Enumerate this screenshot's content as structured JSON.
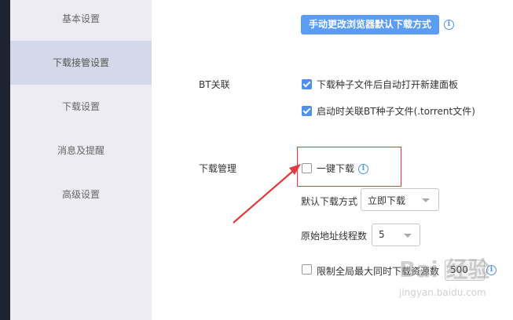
{
  "sidebar": {
    "items": [
      {
        "label": "基本设置"
      },
      {
        "label": "下载接管设置",
        "active": true
      },
      {
        "label": "下载设置"
      },
      {
        "label": "消息及提醒"
      },
      {
        "label": "高级设置"
      }
    ]
  },
  "main": {
    "top_button_label": "手动更改浏览器默认下载方式",
    "bt": {
      "section_label": "BT关联",
      "options": [
        {
          "label": "下载种子文件后自动打开新建面板",
          "checked": true
        },
        {
          "label": "启动时关联BT种子文件(.torrent文件)",
          "checked": true
        }
      ]
    },
    "download_management": {
      "section_label": "下载管理",
      "one_click": {
        "label": "一键下载",
        "checked": false
      },
      "default_mode": {
        "label": "默认下载方式",
        "value": "立即下载"
      },
      "thread_count": {
        "label": "原始地址线程数",
        "value": "5"
      },
      "limit_resources": {
        "label": "限制全局最大同时下载资源数",
        "checked": false,
        "value": "500"
      }
    }
  },
  "watermark": {
    "main": "Bai 经验",
    "sub": "jingyan.baidu.com"
  },
  "colors": {
    "accent": "#4d90f0",
    "button": "#5b9cf5",
    "highlight_box": "#e23b3b",
    "arrow": "#e23b3b"
  }
}
